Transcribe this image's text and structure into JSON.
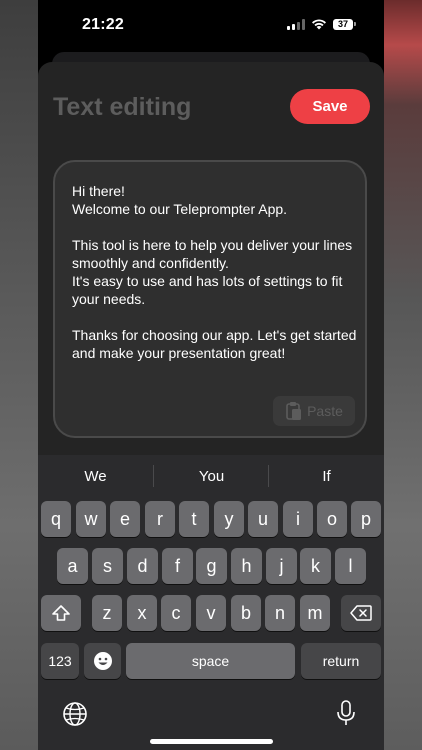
{
  "status_bar": {
    "time": "21:22",
    "battery_level": "37",
    "icons": [
      "signal-icon",
      "wifi-icon",
      "battery-icon"
    ]
  },
  "header": {
    "title": "Text editing",
    "save_label": "Save"
  },
  "editor": {
    "paragraphs": [
      "Hi there!\nWelcome to our Teleprompter App.",
      "This tool is here to help you deliver your lines smoothly and confidently.\nIt's easy to use and has lots of settings to fit your needs.",
      "Thanks for choosing our app. Let's get started and make your presentation great!"
    ],
    "paste_label": "Paste"
  },
  "keyboard": {
    "suggestions": [
      "We",
      "You",
      "If"
    ],
    "row1": [
      "q",
      "w",
      "e",
      "r",
      "t",
      "y",
      "u",
      "i",
      "o",
      "p"
    ],
    "row2": [
      "a",
      "s",
      "d",
      "f",
      "g",
      "h",
      "j",
      "k",
      "l"
    ],
    "row3": [
      "z",
      "x",
      "c",
      "v",
      "b",
      "n",
      "m"
    ],
    "numbers_label": "123",
    "space_label": "space",
    "return_label": "return"
  },
  "colors": {
    "accent": "#ee4045",
    "sheet_bg": "#242424",
    "editor_bg": "#2f2f2f",
    "key_bg": "#6b6b6e",
    "keyboard_bg": "#2b2b2d"
  }
}
